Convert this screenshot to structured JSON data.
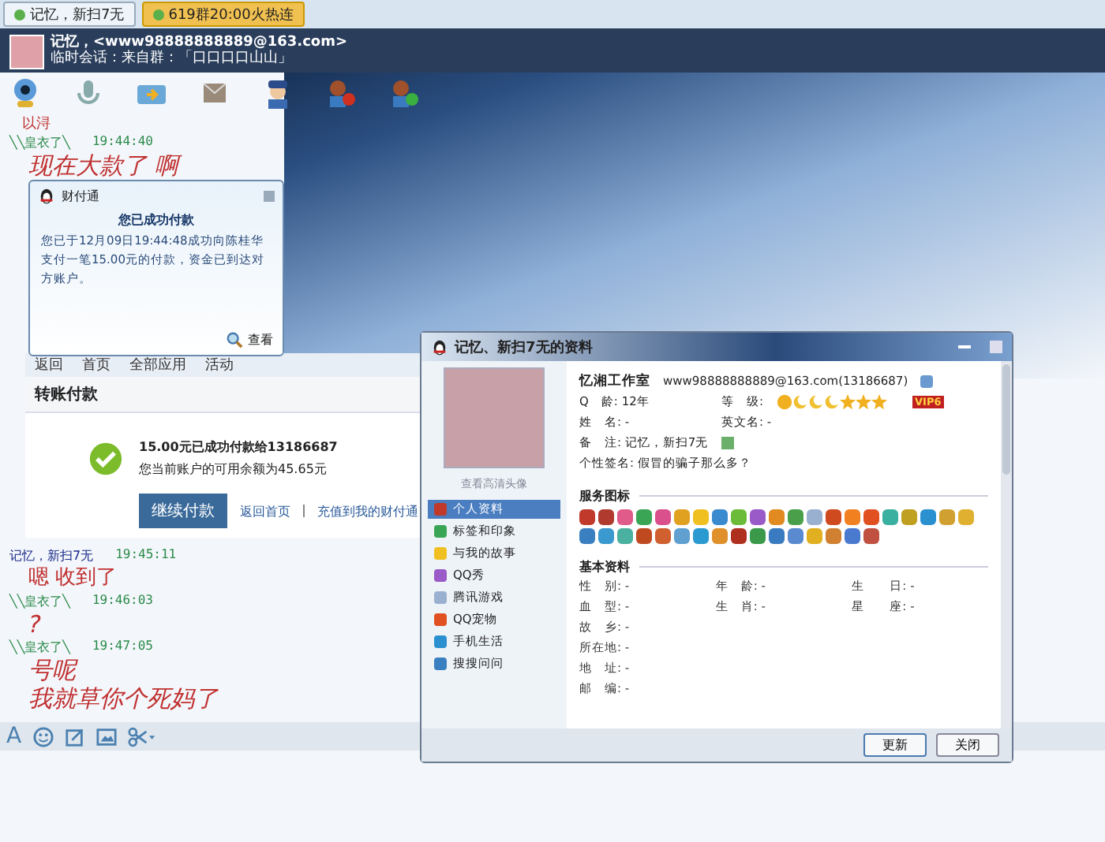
{
  "tabs": [
    {
      "label": "记忆，新扫7无",
      "selected": true
    },
    {
      "label": "619群20:00火热连",
      "selected": false
    }
  ],
  "header": {
    "name": "记忆，<www98888888889@163.com>",
    "subtitle": "临时会话：来自群：「口口口口山山」"
  },
  "chat_log": [
    {
      "kind": "note",
      "text": "以浔"
    },
    {
      "kind": "message",
      "self": false,
      "sender": "╲╲皇衣了╲",
      "time": "19:44:40",
      "lines": [
        "现在大款了 啊"
      ]
    },
    {
      "kind": "payment_page",
      "nav": [
        "返回",
        "首页",
        "全部应用",
        "活动"
      ],
      "title": "转账付款",
      "amount_line": "15.00元已成功付款给13186687",
      "balance_line": "您当前账户的可用余额为45.65元",
      "button": "继续付款",
      "links": [
        "返回首页",
        "充值到我的财付通"
      ]
    },
    {
      "kind": "message",
      "self": true,
      "sender": "记忆，新扫7无",
      "time": "19:45:11",
      "lines": [
        "嗯 收到了"
      ]
    },
    {
      "kind": "message",
      "self": false,
      "sender": "╲╲皇衣了╲",
      "time": "19:46:03",
      "lines": [
        "?"
      ]
    },
    {
      "kind": "message",
      "self": false,
      "sender": "╲╲皇衣了╲",
      "time": "19:47:05",
      "lines": [
        "号呢",
        "我就草你个死妈了"
      ]
    }
  ],
  "input_toolbar": {
    "font_button": "A"
  },
  "popup": {
    "title": "财付通",
    "heading": "您已成功付款",
    "body": "您已于12月09日19:44:48成功向陈桂华支付一笔15.00元的付款，资金已到达对方账户。",
    "action": "查看"
  },
  "profile": {
    "title": "记忆、新扫7无的资料",
    "avatar_link": "查看高清头像",
    "nav": [
      {
        "label": "个人资料",
        "selected": true
      },
      {
        "label": "标签和印象",
        "selected": false
      },
      {
        "label": "与我的故事",
        "selected": false
      },
      {
        "label": "QQ秀",
        "selected": false
      },
      {
        "label": "腾讯游戏",
        "selected": false
      },
      {
        "label": "QQ宠物",
        "selected": false
      },
      {
        "label": "手机生活",
        "selected": false
      },
      {
        "label": "搜搜问问",
        "selected": false
      }
    ],
    "nickname": "忆湘工作室",
    "account": "www98888888889@163.com(13186687)",
    "q_age": {
      "label": "Q　龄:",
      "value": "12年"
    },
    "level": {
      "label": "等　级:"
    },
    "vip_badge": "VIP6",
    "name": {
      "label": "姓　名:",
      "value": "-"
    },
    "english_name": {
      "label": "英文名:",
      "value": "-"
    },
    "remark": {
      "label": "备　注:",
      "value": "记忆，新扫7无"
    },
    "signature": {
      "label": "个性签名:",
      "value": "假冒的骗子那么多？"
    },
    "service_heading": "服务图标",
    "basic_heading": "基本资料",
    "basic_rows": [
      [
        {
          "label": "性　别:",
          "value": "-"
        },
        {
          "label": "年　龄:",
          "value": "-"
        },
        {
          "label": "生　　日:",
          "value": "-"
        }
      ],
      [
        {
          "label": "血　型:",
          "value": "-"
        },
        {
          "label": "生　肖:",
          "value": "-"
        },
        {
          "label": "星　　座:",
          "value": "-"
        }
      ],
      [
        {
          "label": "故　乡:",
          "value": "-"
        }
      ],
      [
        {
          "label": "所在地:",
          "value": "-"
        }
      ],
      [
        {
          "label": "地　址:",
          "value": "-"
        }
      ],
      [
        {
          "label": "邮　编:",
          "value": "-"
        }
      ]
    ],
    "buttons": [
      "更新",
      "关闭"
    ]
  }
}
